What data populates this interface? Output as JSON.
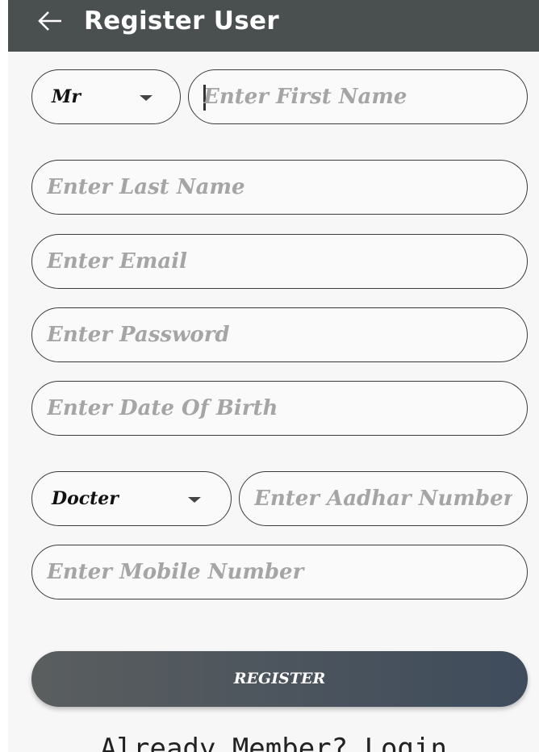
{
  "header": {
    "title": "Register User",
    "back_icon": "arrow-left-icon"
  },
  "form": {
    "title_select": {
      "value": "Mr",
      "icon": "chevron-down-icon"
    },
    "first_name": {
      "placeholder": "Enter First Name",
      "value": ""
    },
    "last_name": {
      "placeholder": "Enter Last Name",
      "value": ""
    },
    "email": {
      "placeholder": "Enter Email",
      "value": ""
    },
    "password": {
      "placeholder": "Enter Password",
      "value": ""
    },
    "dob": {
      "placeholder": "Enter Date Of Birth",
      "value": ""
    },
    "role_select": {
      "value": "Docter",
      "icon": "chevron-down-icon"
    },
    "aadhar": {
      "placeholder": "Enter Aadhar Number",
      "value": ""
    },
    "mobile": {
      "placeholder": "Enter Mobile Number",
      "value": ""
    }
  },
  "actions": {
    "register_label": "REGISTER",
    "login_link": "Already Member? Login"
  },
  "colors": {
    "toolbar": "#4a4f4f",
    "button_start": "#5a5e5f",
    "button_end": "#3f4c5c",
    "placeholder": "#a5a5a5"
  }
}
